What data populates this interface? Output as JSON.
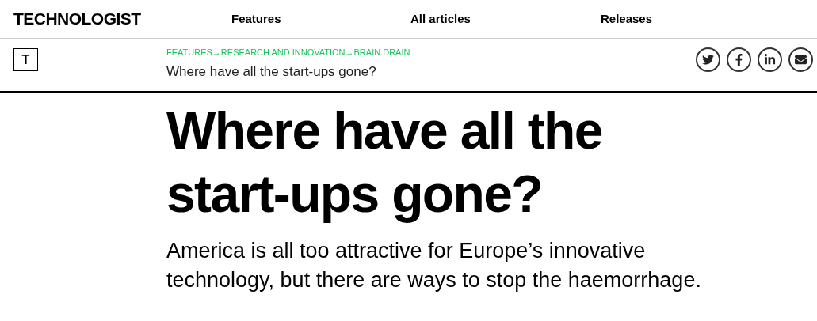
{
  "header": {
    "logo": "TECHNOLOGIST",
    "nav": [
      "Features",
      "All articles",
      "Releases"
    ]
  },
  "article_bar": {
    "logo_mark": "T",
    "breadcrumbs": [
      "FEATURES",
      "RESEARCH AND INNOVATION",
      "BRAIN DRAIN"
    ],
    "separator": "→",
    "title": "Where have all the start-ups gone?",
    "share": [
      {
        "kind": "twitter"
      },
      {
        "kind": "facebook"
      },
      {
        "kind": "linkedin"
      },
      {
        "kind": "email"
      }
    ]
  },
  "article": {
    "headline": "Where have all the start-ups gone?",
    "standfirst": "America is all too attractive for Europe’s innovative technology, but there are ways to stop the haemorrhage."
  }
}
